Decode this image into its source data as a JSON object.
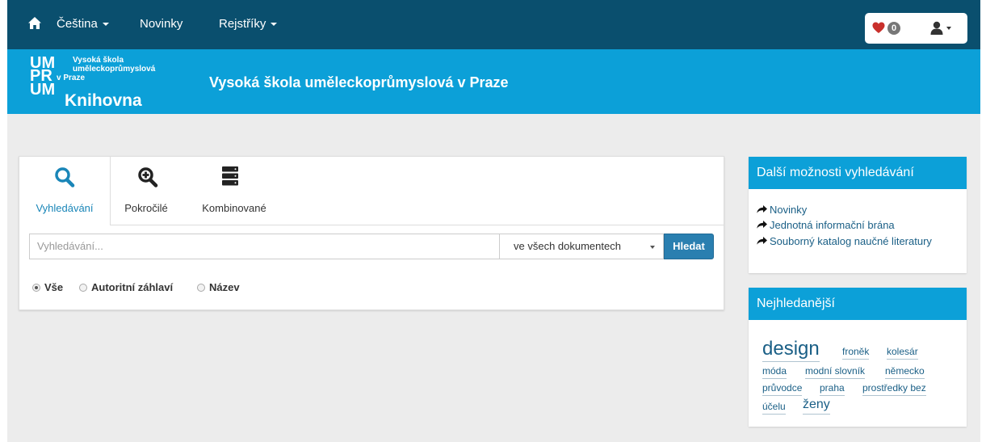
{
  "nav": {
    "home_icon": "home-icon",
    "language_label": "Čeština",
    "news_label": "Novinky",
    "registers_label": "Rejstříky",
    "favorites_count": "0",
    "favorites_icon": "heart-icon",
    "user_icon": "user-icon"
  },
  "header": {
    "logo_lines": [
      "UM",
      "PR",
      "UM"
    ],
    "logo_small": [
      "Vysoká škola",
      "uměleckoprůmyslová",
      "v Praze"
    ],
    "logo_library": "Knihovna",
    "title": "Vysoká škola uměleckoprůmyslová v Praze"
  },
  "search": {
    "tabs": [
      {
        "label": "Vyhledávání",
        "icon": "search-icon",
        "active": true
      },
      {
        "label": "Pokročilé",
        "icon": "zoom-in-icon",
        "active": false
      },
      {
        "label": "Kombinované",
        "icon": "server-icon",
        "active": false
      }
    ],
    "placeholder": "Vyhledávání...",
    "scope_selected": "ve všech dokumentech",
    "button_label": "Hledat",
    "radios": [
      {
        "label": "Vše",
        "checked": true
      },
      {
        "label": "Autoritní záhlaví",
        "checked": false
      },
      {
        "label": "Název",
        "checked": false
      }
    ]
  },
  "more_options": {
    "title": "Další možnosti vyhledávání",
    "items": [
      "Novinky",
      "Jednotná informační brána",
      "Souborný katalog naučné literatury"
    ]
  },
  "popular": {
    "title": "Nejhledanější",
    "tags": [
      "design",
      "froněk",
      "kolesár",
      "móda",
      "modní slovník",
      "německo",
      "průvodce",
      "praha",
      "prostředky bez",
      "účelu",
      "ženy"
    ]
  },
  "colors": {
    "navbar": "#0a4f6e",
    "header": "#0ca0d8",
    "accent_button": "#2a7fb0",
    "link": "#1a5f86",
    "background": "#ececec"
  }
}
